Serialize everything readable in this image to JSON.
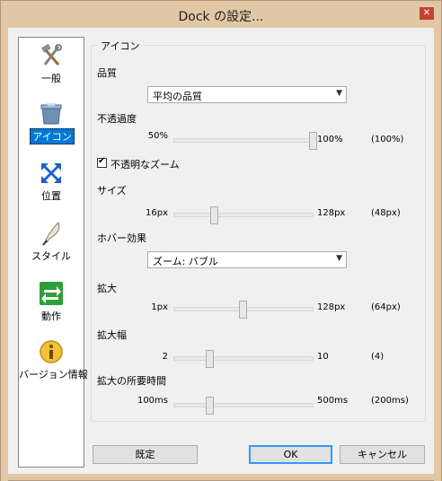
{
  "window": {
    "title": "Dock の設定...",
    "close_symbol": "✕"
  },
  "sidebar": {
    "items": [
      {
        "label": "一般",
        "icon": "tools-icon"
      },
      {
        "label": "アイコン",
        "icon": "recycle-bin-icon",
        "selected": true
      },
      {
        "label": "位置",
        "icon": "move-arrows-icon"
      },
      {
        "label": "スタイル",
        "icon": "quill-icon"
      },
      {
        "label": "動作",
        "icon": "exchange-arrows-icon"
      },
      {
        "label": "バージョン情報",
        "icon": "info-icon"
      }
    ]
  },
  "group": {
    "title": "アイコン",
    "quality": {
      "label": "品質",
      "value": "平均の品質"
    },
    "opacity": {
      "label": "不透過度",
      "min": "50%",
      "max": "100%",
      "current": "(100%)",
      "fraction": 1.0
    },
    "opaque_zoom": {
      "label": "不透明なズーム",
      "checked": true
    },
    "size": {
      "label": "サイズ",
      "min": "16px",
      "max": "128px",
      "current": "(48px)",
      "fraction": 0.2857
    },
    "hover_effect": {
      "label": "ホバー効果",
      "value": "ズーム: バブル"
    },
    "zoom": {
      "label": "拡大",
      "min": "1px",
      "max": "128px",
      "current": "(64px)",
      "fraction": 0.496
    },
    "zoom_width": {
      "label": "拡大幅",
      "min": "2",
      "max": "10",
      "current": "(4)",
      "fraction": 0.25
    },
    "zoom_time": {
      "label": "拡大の所要時間",
      "min": "100ms",
      "max": "500ms",
      "current": "(200ms)",
      "fraction": 0.25
    }
  },
  "buttons": {
    "default": "既定",
    "ok": "OK",
    "cancel": "キャンセル"
  }
}
